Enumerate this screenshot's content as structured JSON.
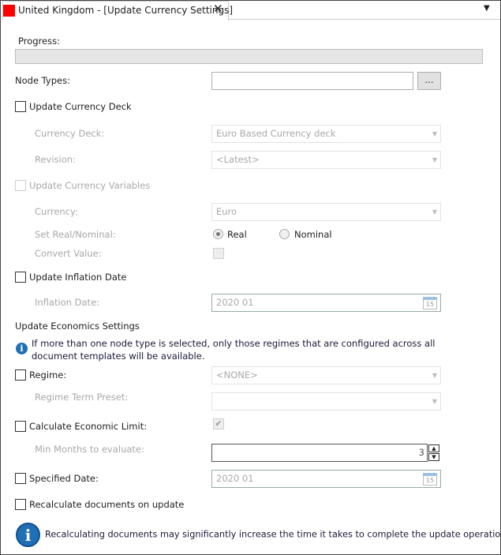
{
  "tab": {
    "title": "United Kingdom - [Update Currency Settings]",
    "flag_color": "#ff0000",
    "close_icon": "close-icon",
    "menu_icon": "chevron-down-icon"
  },
  "progress": {
    "label": "Progress:",
    "value": 0
  },
  "node_types": {
    "label": "Node Types:",
    "value": "",
    "browse_label": "..."
  },
  "currency_deck": {
    "checkbox_label": "Update Currency Deck",
    "checked": false,
    "deck_label": "Currency Deck:",
    "deck_value": "Euro Based Currency deck",
    "revision_label": "Revision:",
    "revision_value": "<Latest>"
  },
  "currency_variables": {
    "checkbox_label": "Update Currency Variables",
    "currency_label": "Currency:",
    "currency_value": "Euro",
    "real_nominal_label": "Set Real/Nominal:",
    "real_label": "Real",
    "nominal_label": "Nominal",
    "selected": "Real",
    "convert_label": "Convert Value:"
  },
  "inflation": {
    "checkbox_label": "Update Inflation Date",
    "date_label": "Inflation Date:",
    "date_value": "2020 01",
    "calendar_day": "15"
  },
  "economics": {
    "heading": "Update Economics Settings",
    "info_line1": "If more than one node type is selected, only those regimes that are configured across all",
    "info_line2": "document templates will be available.",
    "regime_label": "Regime:",
    "regime_value": "<NONE>",
    "preset_label": "Regime Term Preset:",
    "preset_value": "",
    "econ_limit_label": "Calculate Economic Limit:",
    "econ_limit_checked": true,
    "min_months_label": "Min Months to evaluate:",
    "min_months_value": "3",
    "specified_date_label": "Specified Date:",
    "specified_date_value": "2020 01",
    "calendar_day": "15"
  },
  "recalculate": {
    "checkbox_label": "Recalculate documents on update",
    "checked": false,
    "info": "Recalculating documents may significantly increase the time it takes to complete the update operation."
  }
}
